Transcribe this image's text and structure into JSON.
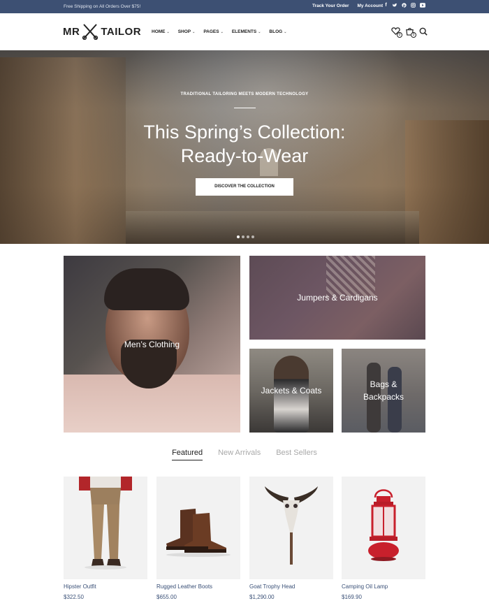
{
  "topbar": {
    "shipping": "Free Shipping on All Orders Over $75!",
    "track_order": "Track Your Order",
    "my_account": "My Account",
    "social": [
      "facebook-icon",
      "twitter-icon",
      "pinterest-icon",
      "instagram-icon",
      "youtube-icon"
    ]
  },
  "header": {
    "logo_left": "MR",
    "logo_right": "TAILOR",
    "nav": [
      {
        "label": "HOME"
      },
      {
        "label": "SHOP"
      },
      {
        "label": "PAGES"
      },
      {
        "label": "ELEMENTS"
      },
      {
        "label": "BLOG"
      }
    ],
    "wishlist_count": "0",
    "cart_count": "0"
  },
  "hero": {
    "eyebrow": "TRADITIONAL TAILORING MEETS MODERN TECHNOLOGY",
    "headline_line1": "This Spring’s Collection:",
    "headline_line2": "Ready-to-Wear",
    "cta": "DISCOVER THE COLLECTION",
    "slides": 4,
    "active_slide": 1
  },
  "categories": {
    "mens": "Men’s Clothing",
    "jumpers": "Jumpers & Cardigans",
    "jackets": "Jackets & Coats",
    "bags_line1": "Bags &",
    "bags_line2": "Backpacks"
  },
  "tabs": {
    "featured": "Featured",
    "new_arrivals": "New Arrivals",
    "best_sellers": "Best Sellers",
    "active": "Featured"
  },
  "products": [
    {
      "name": "Hipster Outfit",
      "price": "$322.50"
    },
    {
      "name": "Rugged Leather Boots",
      "price": "$655.00"
    },
    {
      "name": "Goat Trophy Head",
      "price": "$1,290.00"
    },
    {
      "name": "Camping Oil Lamp",
      "price": "$169.90"
    }
  ],
  "colors": {
    "topbar_bg": "#3d5073",
    "link_blue": "#3a5077",
    "lamp_red": "#c8202c"
  }
}
